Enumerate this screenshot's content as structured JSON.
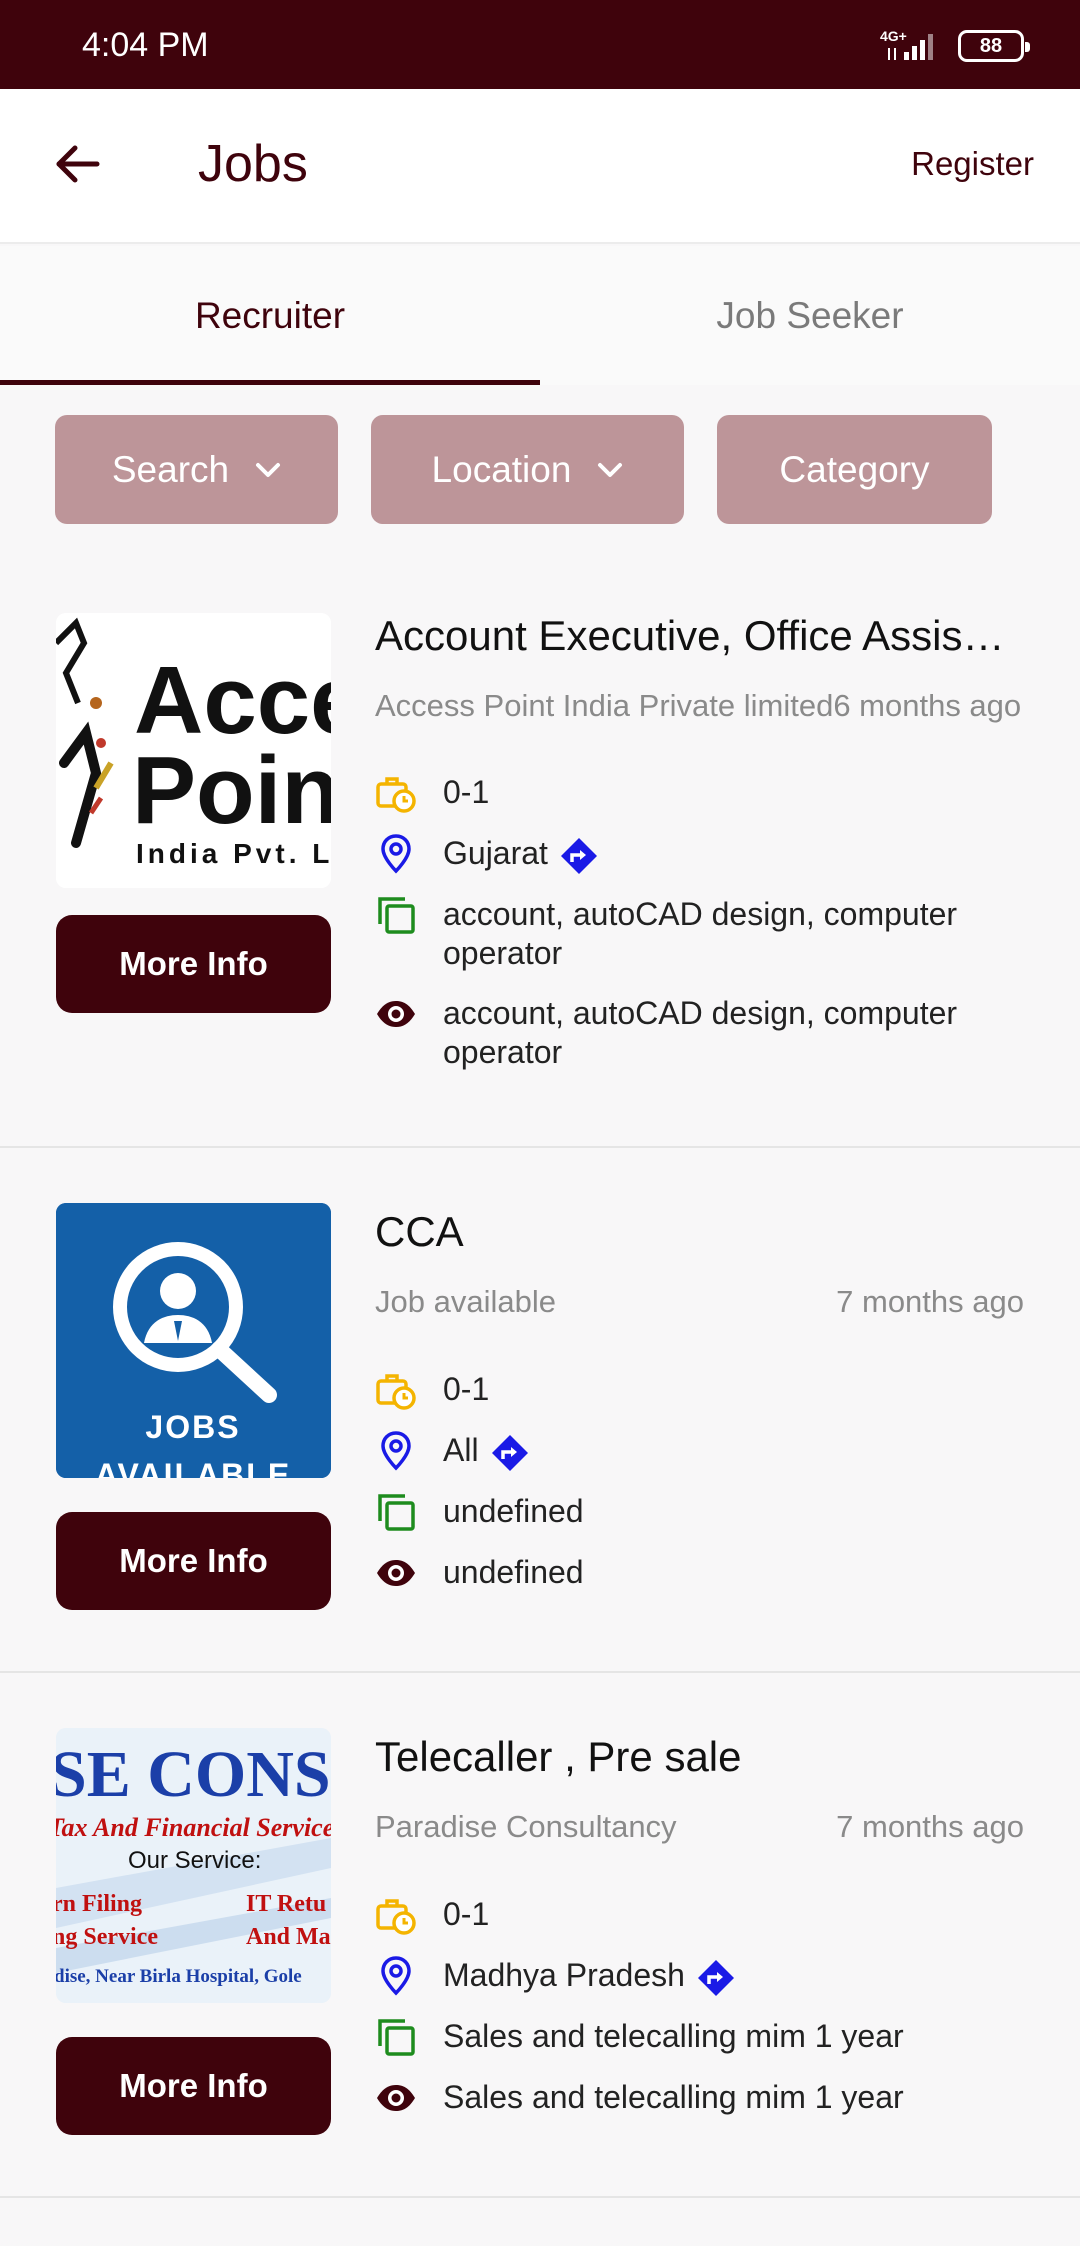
{
  "status_bar": {
    "time": "4:04 PM",
    "network": "4G+",
    "battery": "88"
  },
  "app_bar": {
    "title": "Jobs",
    "register": "Register"
  },
  "tabs": [
    {
      "label": "Recruiter",
      "active": true
    },
    {
      "label": "Job Seeker",
      "active": false
    }
  ],
  "filters": {
    "search": "Search",
    "location": "Location",
    "category": "Category"
  },
  "colors": {
    "primary": "#3f030c",
    "filter_bg": "#bd9599",
    "exp_icon": "#f4b400",
    "location_icon": "#1a1ae6",
    "category_icon": "#1e8c1e"
  },
  "jobs": [
    {
      "title": "Account Executive, Office Assis…",
      "company": "Access Point India Private limited",
      "posted": "6 months ago",
      "experience": "0-1",
      "location": "Gujarat",
      "category": "account, autoCAD design, computer operator",
      "skills": "account, autoCAD design, computer operator",
      "logo": {
        "line1": "Acce",
        "line2": "Poin",
        "line3": "India Pvt. L"
      },
      "more_info": "More Info"
    },
    {
      "title": "CCA",
      "company": "Job available",
      "posted": "7 months ago",
      "experience": "0-1",
      "location": "All",
      "category": "undefined",
      "skills": "undefined",
      "logo": {
        "line1": "JOBS",
        "line2": "AVAILABLE"
      },
      "more_info": "More Info"
    },
    {
      "title": "Telecaller , Pre sale",
      "company": "Paradise Consultancy",
      "posted": "7 months ago",
      "experience": "0-1",
      "location": "Madhya Pradesh",
      "category": "Sales and telecalling mim 1 year",
      "skills": "Sales and telecalling mim 1 year",
      "logo": {
        "line1": "SE CONSUL",
        "line2": "Tax And Financial Service",
        "line3": "Our Service:",
        "line4": "rn Filing",
        "line5": "IT Retu",
        "line6": "ng Service",
        "line7": "And Ma",
        "line8": "dise, Near Birla Hospital, Gole"
      },
      "more_info": "More Info"
    }
  ]
}
